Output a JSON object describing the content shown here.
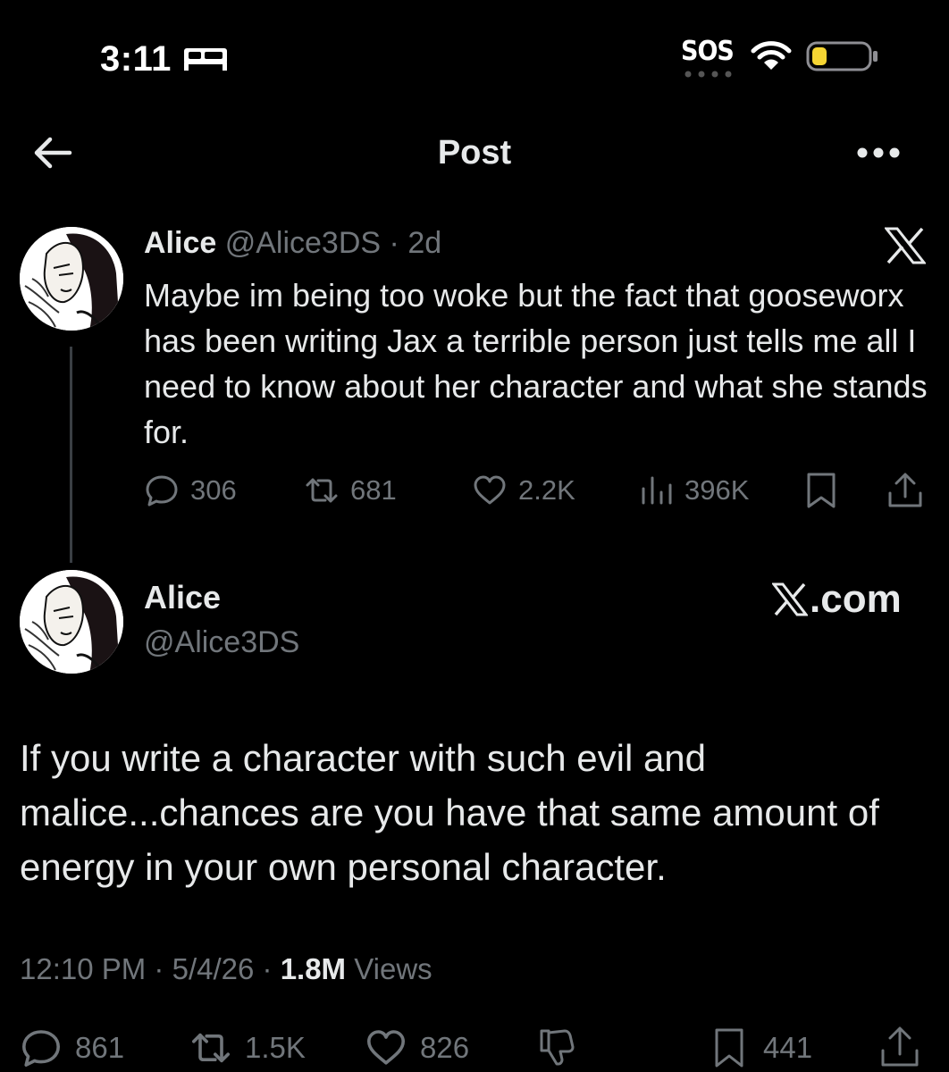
{
  "status_bar": {
    "time": "3:11",
    "sos": "SOS",
    "icons": [
      "bed-icon",
      "wifi-icon",
      "battery-icon"
    ]
  },
  "nav": {
    "title": "Post",
    "icons": [
      "back-arrow-icon",
      "more-icon"
    ]
  },
  "quoted_post": {
    "name": "Alice",
    "handle": "@Alice3DS",
    "separator": "·",
    "age": "2d",
    "text": "Maybe im being too woke but the fact that gooseworx has been writing Jax a terrible person just tells me all I need to know about her character and what she stands for.",
    "stats": {
      "replies": "306",
      "reposts": "681",
      "likes": "2.2K",
      "views": "396K"
    }
  },
  "main_post": {
    "name": "Alice",
    "handle": "@Alice3DS",
    "source": ".com",
    "text": "If you write a character with such evil and malice...chances are you have that same amount of energy in your own personal character.",
    "time": "12:10 PM",
    "date": "5/4/26",
    "separator": "·",
    "views_count": "1.8M",
    "views_label": "Views",
    "stats": {
      "replies": "861",
      "reposts": "1.5K",
      "likes": "826",
      "bookmarks": "441"
    }
  },
  "colors": {
    "background": "#000000",
    "text": "#e7e9ea",
    "muted": "#71767b",
    "battery": "#f5d533"
  }
}
